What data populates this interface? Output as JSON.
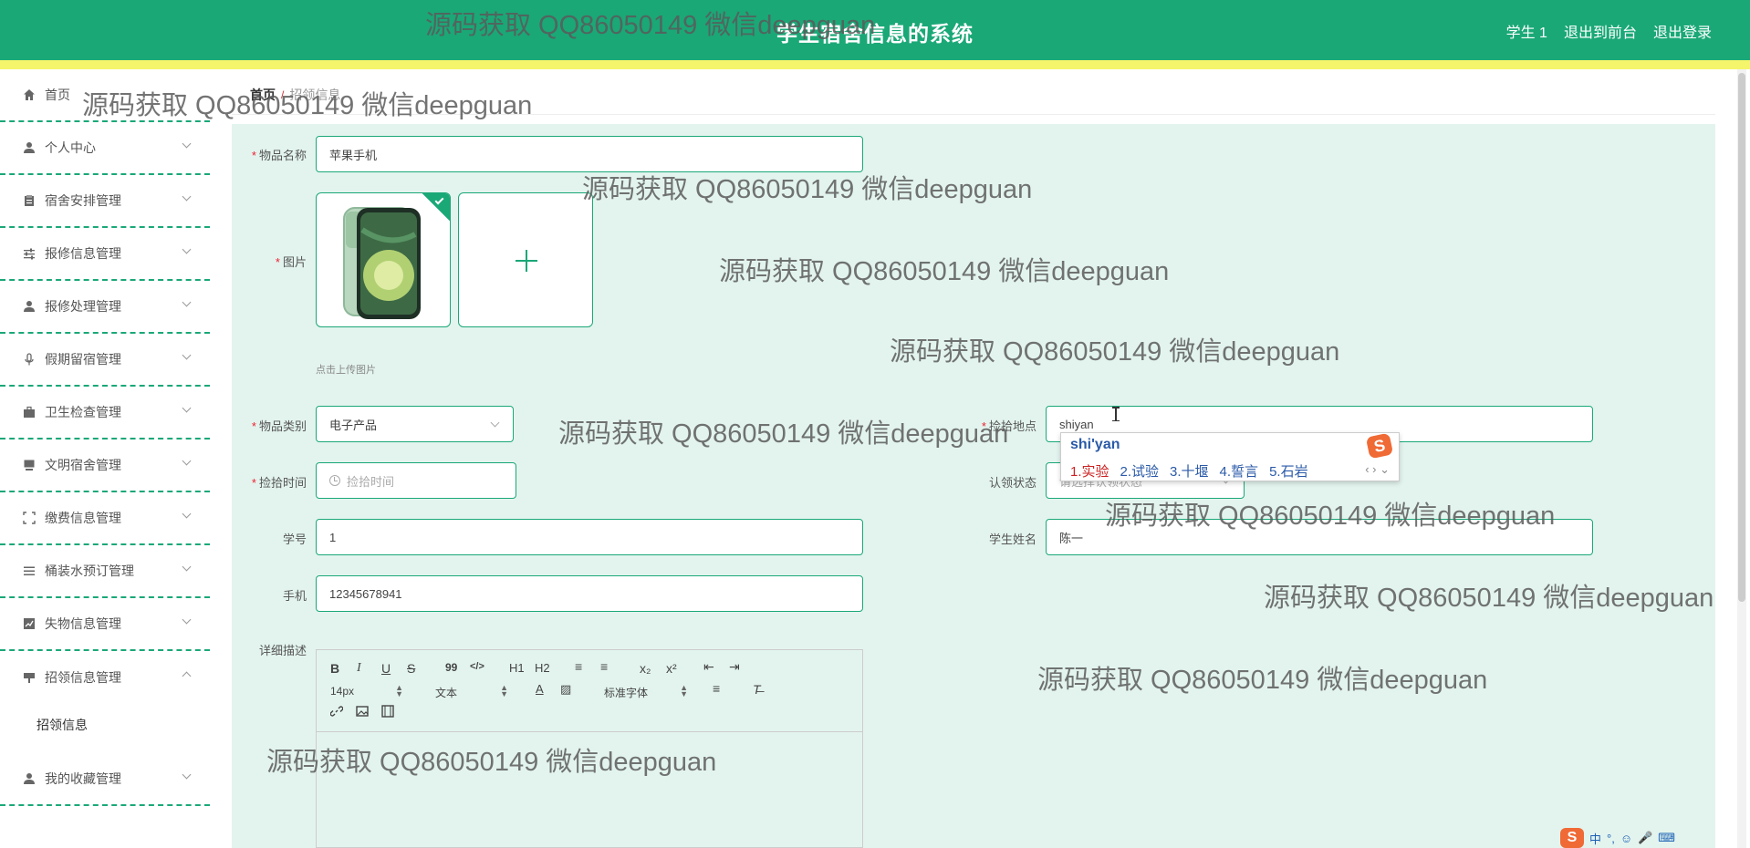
{
  "header": {
    "title": "学生宿舍信息的系统",
    "links": [
      "学生 1",
      "退出到前台",
      "退出登录"
    ]
  },
  "sidebar": {
    "items": [
      {
        "label": "首页",
        "icon": "home-icon"
      },
      {
        "label": "个人中心",
        "icon": "user-icon"
      },
      {
        "label": "宿舍安排管理",
        "icon": "clipboard-icon"
      },
      {
        "label": "报修信息管理",
        "icon": "sliders-icon"
      },
      {
        "label": "报修处理管理",
        "icon": "user-icon"
      },
      {
        "label": "假期留宿管理",
        "icon": "microphone-icon"
      },
      {
        "label": "卫生检查管理",
        "icon": "briefcase-icon"
      },
      {
        "label": "文明宿舍管理",
        "icon": "monitor-icon"
      },
      {
        "label": "缴费信息管理",
        "icon": "fullscreen-icon"
      },
      {
        "label": "桶装水预订管理",
        "icon": "list-icon"
      },
      {
        "label": "失物信息管理",
        "icon": "chart-icon"
      },
      {
        "label": "招领信息管理",
        "icon": "tag-icon"
      },
      {
        "label": "我的收藏管理",
        "icon": "user-icon"
      }
    ],
    "submenu": {
      "label": "招领信息"
    }
  },
  "breadcrumb": {
    "home": "首页",
    "separator": "/",
    "current": "招领信息"
  },
  "form": {
    "name_label": "物品名称",
    "name_value": "苹果手机",
    "image_label": "图片",
    "upload_hint": "点击上传图片",
    "category_label": "物品类别",
    "category_value": "电子产品",
    "place_label": "捡拾地点",
    "place_value": "shiyan",
    "time_label": "捡拾时间",
    "time_placeholder": "捡拾时间",
    "claim_label": "认领状态",
    "claim_placeholder": "请选择认领状态",
    "student_no_label": "学号",
    "student_no_value": "1",
    "student_name_label": "学生姓名",
    "student_name_value": "陈一",
    "phone_label": "手机",
    "phone_value": "12345678941",
    "detail_label": "详细描述"
  },
  "editor": {
    "buttons": [
      "B",
      "I",
      "U",
      "S",
      "99",
      "</>",
      "H1",
      "H2",
      "≡",
      "≡",
      "x₂",
      "x²",
      "⇤",
      "⇥"
    ],
    "font_size": "14px",
    "text_type": "文本",
    "font_family": "标准字体"
  },
  "ime": {
    "composition": "shi'yan",
    "candidates": [
      "1.实验",
      "2.试验",
      "3.十堰",
      "4.誓言",
      "5.石岩"
    ],
    "logo": "S",
    "tray": [
      "S",
      "中",
      "°,",
      "☺",
      "🎤",
      "⌨"
    ]
  },
  "watermark": "源码获取 QQ86050149 微信deepguan",
  "colors": {
    "primary": "#1aa877",
    "strip": "#f5f56b",
    "panel": "#e3f4ee"
  }
}
